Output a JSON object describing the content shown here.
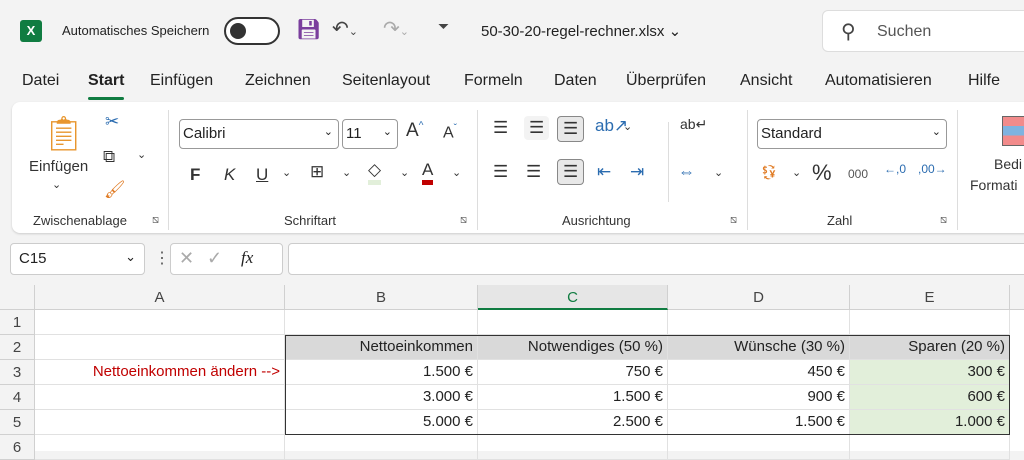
{
  "titlebar": {
    "app_icon": "excel-icon",
    "autosave_label": "Automatisches Speichern",
    "autosave_on": false,
    "filename": "50-30-20-regel-rechner.xlsx",
    "search_placeholder": "Suchen"
  },
  "menu": [
    "Datei",
    "Start",
    "Einfügen",
    "Zeichnen",
    "Seitenlayout",
    "Formeln",
    "Daten",
    "Überprüfen",
    "Ansicht",
    "Automatisieren",
    "Hilfe"
  ],
  "ribbon": {
    "clipboard": {
      "label": "Zwischenablage",
      "paste": "Einfügen"
    },
    "font": {
      "label": "Schriftart",
      "font_name": "Calibri",
      "font_size": "11",
      "bold": "F",
      "italic": "K",
      "underline": "U",
      "font_color": "#c00000",
      "fill_color": "#e2efda"
    },
    "alignment": {
      "label": "Ausrichtung"
    },
    "number": {
      "label": "Zahl",
      "format": "Standard",
      "percent": "%",
      "thousands": "000"
    },
    "styles": {
      "cond_format": "Bedi",
      "cond_format2": "Formati"
    }
  },
  "formula_bar": {
    "name_box": "C15",
    "fx": "fx",
    "value": ""
  },
  "grid": {
    "columns": [
      "A",
      "B",
      "C",
      "D",
      "E"
    ],
    "selected_column": "C",
    "rows": [
      "1",
      "2",
      "3",
      "4",
      "5",
      "6"
    ],
    "a3_label": "Nettoeinkommen ändern -->",
    "a3_color": "#c00000",
    "headers": [
      "Nettoeinkommen",
      "Notwendiges (50 %)",
      "Wünsche (30 %)",
      "Sparen (20 %)"
    ],
    "data": [
      [
        "1.500 €",
        "750 €",
        "450 €",
        "300 €"
      ],
      [
        "3.000 €",
        "1.500 €",
        "900 €",
        "600 €"
      ],
      [
        "5.000 €",
        "2.500 €",
        "1.500 €",
        "1.000 €"
      ]
    ],
    "header_fill": "#d9d9d9",
    "savings_fill": "#e2efda"
  }
}
